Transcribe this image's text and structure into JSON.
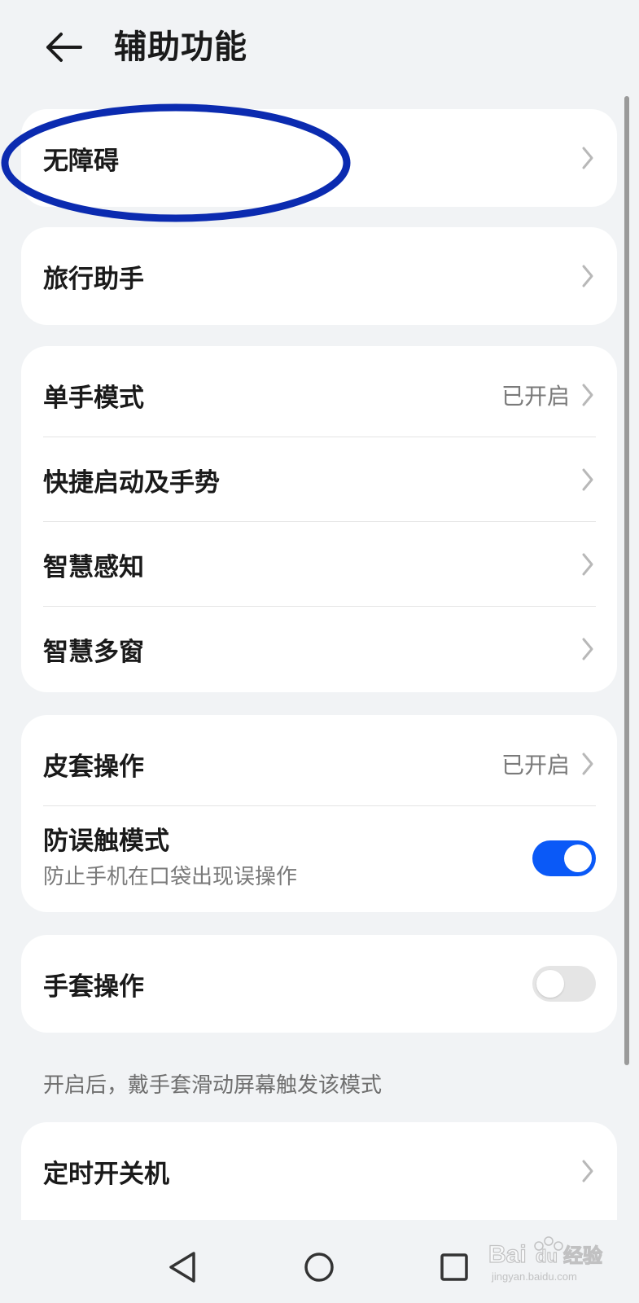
{
  "header": {
    "title": "辅助功能",
    "back_icon": "arrow-left-icon"
  },
  "cards": {
    "accessibility": {
      "label": "无障碍"
    },
    "travel_assistant": {
      "label": "旅行助手"
    },
    "one_handed_mode": {
      "label": "单手模式",
      "value": "已开启"
    },
    "shortcuts_gestures": {
      "label": "快捷启动及手势"
    },
    "smart_awareness": {
      "label": "智慧感知"
    },
    "smart_multiwindow": {
      "label": "智慧多窗"
    },
    "cover_operation": {
      "label": "皮套操作",
      "value": "已开启"
    },
    "accidental_touch": {
      "label": "防误触模式",
      "sub": "防止手机在口袋出现误操作",
      "toggle": true
    },
    "glove_mode": {
      "label": "手套操作",
      "toggle": false
    },
    "glove_footnote": "开启后，戴手套滑动屏幕触发该模式",
    "scheduled_power": {
      "label": "定时开关机"
    }
  },
  "colors": {
    "accent": "#0a59f7",
    "highlight_ellipse": "#0b2bb0",
    "background": "#f1f3f5"
  },
  "navbar": {
    "icons": [
      "triangle-back-icon",
      "circle-home-icon",
      "square-recents-icon"
    ]
  },
  "watermark": {
    "text": "Baidu经验",
    "url": "jingyan.baidu.com"
  }
}
